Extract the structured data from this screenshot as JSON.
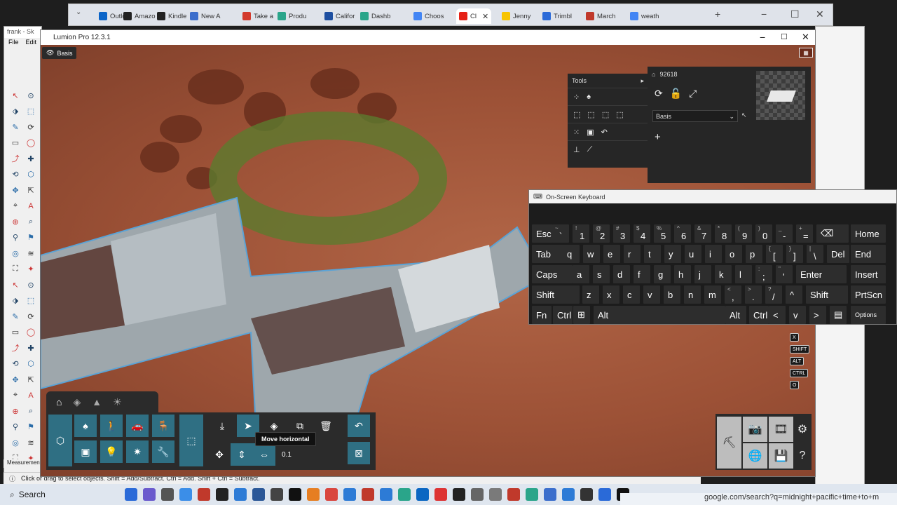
{
  "browser": {
    "tabs": [
      {
        "label": "Outlo",
        "color": "#0a64c8"
      },
      {
        "label": "Amazo",
        "color": "#222222"
      },
      {
        "label": "Kindle",
        "color": "#222222"
      },
      {
        "label": "New A",
        "color": "#3b6ecc"
      },
      {
        "label": "Take a",
        "color": "#d33a2c"
      },
      {
        "label": "Produ",
        "color": "#2aa58a"
      },
      {
        "label": "Califor",
        "color": "#1e4fa0"
      },
      {
        "label": "Dashb",
        "color": "#2aa58a"
      },
      {
        "label": "Choos",
        "color": "#4285f4"
      },
      {
        "label": "Cl",
        "color": "#e62117"
      },
      {
        "label": "Jenny",
        "color": "#f7c400"
      },
      {
        "label": "Trimbl",
        "color": "#2a6ad8"
      },
      {
        "label": "March",
        "color": "#c0392b"
      },
      {
        "label": "weath",
        "color": "#4285f4"
      }
    ],
    "new_tab": "+"
  },
  "sketchup": {
    "title": "frank - Sk",
    "menu": [
      "File",
      "Edit"
    ],
    "measurements": "Measurement",
    "status": "Click or drag to select objects. Shift = Add/Subtract. Ctrl = Add. Shift + Ctrl = Subtract."
  },
  "lumion": {
    "title": "Lumion Pro 12.3.1",
    "layer_tag": "Basis",
    "tools_panel": {
      "title": "Tools"
    },
    "object_panel": {
      "id": "92618",
      "layer": "Basis",
      "add": "+"
    },
    "tooltip": "Move horizontal",
    "value_field": "0.1",
    "side_keys": [
      "X",
      "SHIFT",
      "ALT",
      "CTRL",
      "O"
    ]
  },
  "osk": {
    "title": "On-Screen Keyboard",
    "rows": [
      [
        {
          "m": "Esc"
        },
        {
          "s": "~",
          "m": "`"
        },
        {
          "s": "!",
          "m": "1"
        },
        {
          "s": "@",
          "m": "2"
        },
        {
          "s": "#",
          "m": "3"
        },
        {
          "s": "$",
          "m": "4"
        },
        {
          "s": "%",
          "m": "5"
        },
        {
          "s": "^",
          "m": "6"
        },
        {
          "s": "&",
          "m": "7"
        },
        {
          "s": "*",
          "m": "8"
        },
        {
          "s": "(",
          "m": "9"
        },
        {
          "s": ")",
          "m": "0"
        },
        {
          "s": "_",
          "m": "-"
        },
        {
          "s": "+",
          "m": "="
        },
        {
          "m": "⌫"
        },
        {
          "m": "Home"
        }
      ],
      [
        {
          "m": "Tab"
        },
        {
          "m": "q"
        },
        {
          "m": "w"
        },
        {
          "m": "e"
        },
        {
          "m": "r"
        },
        {
          "m": "t"
        },
        {
          "m": "y"
        },
        {
          "m": "u"
        },
        {
          "m": "i"
        },
        {
          "m": "o"
        },
        {
          "m": "p"
        },
        {
          "s": "{",
          "m": "["
        },
        {
          "s": "}",
          "m": "]"
        },
        {
          "s": "|",
          "m": "\\"
        },
        {
          "m": "Del"
        },
        {
          "m": "End"
        }
      ],
      [
        {
          "m": "Caps"
        },
        {
          "m": "a"
        },
        {
          "m": "s"
        },
        {
          "m": "d"
        },
        {
          "m": "f"
        },
        {
          "m": "g"
        },
        {
          "m": "h"
        },
        {
          "m": "j"
        },
        {
          "m": "k"
        },
        {
          "m": "l"
        },
        {
          "s": ":",
          "m": ";"
        },
        {
          "s": "\"",
          "m": "'"
        },
        {
          "m": "Enter"
        },
        {
          "m": "Insert"
        }
      ],
      [
        {
          "m": "Shift"
        },
        {
          "m": "z"
        },
        {
          "m": "x"
        },
        {
          "m": "c"
        },
        {
          "m": "v"
        },
        {
          "m": "b"
        },
        {
          "m": "n"
        },
        {
          "m": "m"
        },
        {
          "s": "<",
          "m": ","
        },
        {
          "s": ">",
          "m": "."
        },
        {
          "s": "?",
          "m": "/"
        },
        {
          "m": "^"
        },
        {
          "m": "Shift"
        },
        {
          "m": "PrtScn"
        }
      ],
      [
        {
          "m": "Fn"
        },
        {
          "m": "Ctrl"
        },
        {
          "m": "⊞"
        },
        {
          "m": "Alt"
        },
        {
          "m": ""
        },
        {
          "m": "Alt"
        },
        {
          "m": "Ctrl"
        },
        {
          "m": "<"
        },
        {
          "m": "v"
        },
        {
          "m": ">"
        },
        {
          "m": "▤"
        },
        {
          "m": "Options"
        }
      ]
    ]
  },
  "taskbar": {
    "search": "Search",
    "address": "google.com/search?q=midnight+pacific+time+to+m"
  }
}
